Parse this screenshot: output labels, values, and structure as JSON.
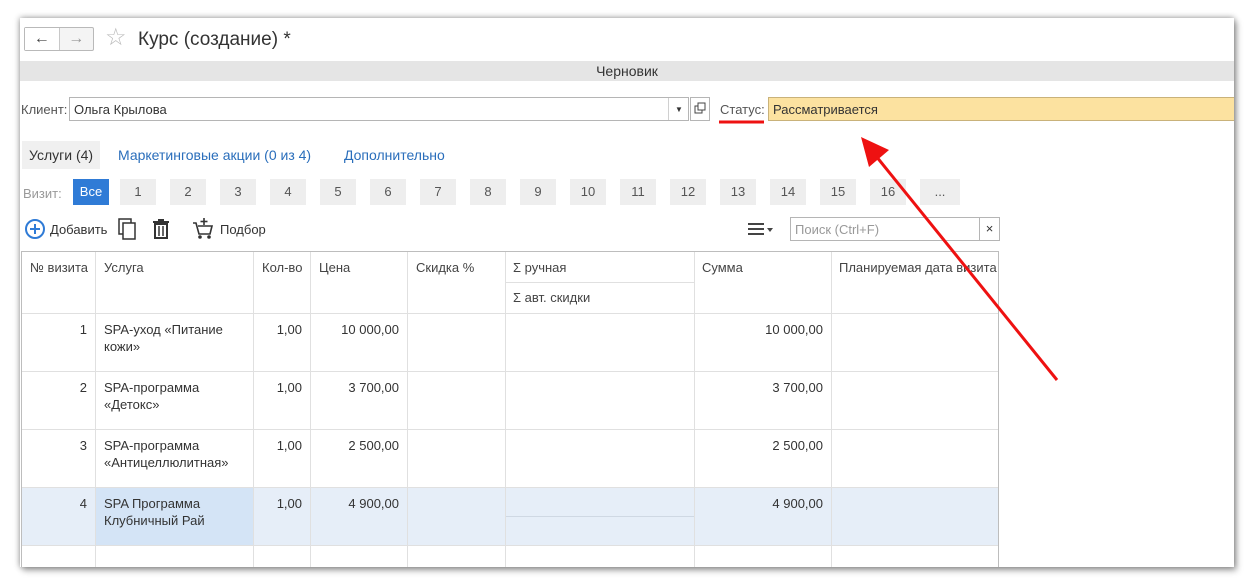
{
  "window": {
    "title": "Курс (создание) *",
    "back_icon": "←",
    "forward_icon": "→",
    "star_icon": "☆"
  },
  "status_banner": "Черновик",
  "client": {
    "label": "Клиент:",
    "value": "Ольга Крылова"
  },
  "status": {
    "label": "Статус:",
    "value": "Рассматривается",
    "color": "#fce2a0"
  },
  "tabs": [
    {
      "label": "Услуги (4)"
    },
    {
      "label": "Маркетинговые акции (0 из 4)"
    },
    {
      "label": "Дополнительно"
    }
  ],
  "visits": {
    "label": "Визит:",
    "items": [
      "Все",
      "1",
      "2",
      "3",
      "4",
      "5",
      "6",
      "7",
      "8",
      "9",
      "10",
      "11",
      "12",
      "13",
      "14",
      "15",
      "16",
      "..."
    ]
  },
  "toolbar": {
    "add_label": "Добавить",
    "select_label": "Подбор",
    "search_placeholder": "Поиск (Ctrl+F)",
    "clear_icon": "×"
  },
  "table": {
    "headers": {
      "visit_no": "№ визита",
      "service": "Услуга",
      "qty": "Кол-во",
      "price": "Цена",
      "discount": "Скидка %",
      "manual": "Σ ручная",
      "auto": "Σ авт. скидки",
      "sum": "Сумма",
      "planned_date": "Планируемая дата визита"
    },
    "rows": [
      {
        "visit_no": "1",
        "service_l1": "SPA-уход «Питание",
        "service_l2": "кожи»",
        "qty": "1,00",
        "price": "10 000,00",
        "sum": "10 000,00"
      },
      {
        "visit_no": "2",
        "service_l1": "SPA-программа",
        "service_l2": "«Детокс»",
        "qty": "1,00",
        "price": "3 700,00",
        "sum": "3 700,00"
      },
      {
        "visit_no": "3",
        "service_l1": "SPA-программа",
        "service_l2": "«Антицеллюлитная»",
        "qty": "1,00",
        "price": "2 500,00",
        "sum": "2 500,00"
      },
      {
        "visit_no": "4",
        "service_l1": "SPA Программа",
        "service_l2": "Клубничный Рай",
        "qty": "1,00",
        "price": "4 900,00",
        "sum": "4 900,00"
      }
    ]
  },
  "colors": {
    "accent": "#2f7bd6",
    "link": "#2a6ebb",
    "annotation_red": "#ee1111",
    "selected_row": "#e6eef8",
    "selected_cell": "#d4e4f6"
  }
}
